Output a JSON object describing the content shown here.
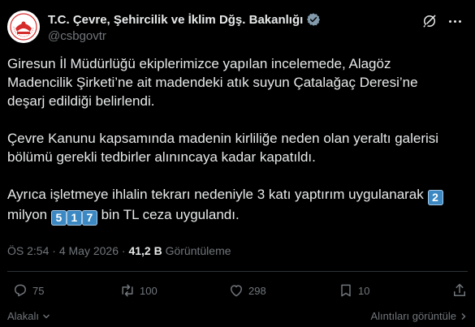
{
  "account": {
    "display_name": "T.C. Çevre, Şehircilik ve İklim Dğş. Bakanlığı",
    "handle": "@csbgovtr"
  },
  "tweet": {
    "p1_line1": "Giresun İl Müdürlüğü ekiplerimizce yapılan incelemede, Alagöz",
    "p1_line2": "Madencilik Şirketi’ne ait madendeki atık suyun Çatalağaç Deresi’ne",
    "p1_line3": "deşarj edildiği belirlendi.",
    "p2_line1": "Çevre Kanunu kapsamında madenin kirliliğe neden olan yeraltı galerisi",
    "p2_line2": "bölümü gerekli tedbirler alınıncaya kadar kapatıldı.",
    "p3_line1": "Ayrıca işletmeye ihlalin tekrarı nedeniyle 3 katı yaptırım uygulanarak",
    "p3_keycap1": "2",
    "p3_line2_start": "milyon",
    "p3_keycap2": "5",
    "p3_keycap3": "1",
    "p3_keycap4": "7",
    "p3_line2_end": "bin TL ceza uygulandı."
  },
  "meta": {
    "time": "ÖS 2:54",
    "separator": "·",
    "date": "4 May 2026",
    "views_count": "41,2 B",
    "views_label": "Görüntüleme"
  },
  "actions": {
    "replies": "75",
    "reposts": "100",
    "likes": "298",
    "bookmarks": "10"
  },
  "footer": {
    "left_label": "Alakalı",
    "right_label": "Alıntıları görüntüle"
  },
  "colors": {
    "background": "#000000",
    "text": "#e7e9ea",
    "muted": "#71767b",
    "verified": "#829aab",
    "keycap": "#3b88c3"
  }
}
